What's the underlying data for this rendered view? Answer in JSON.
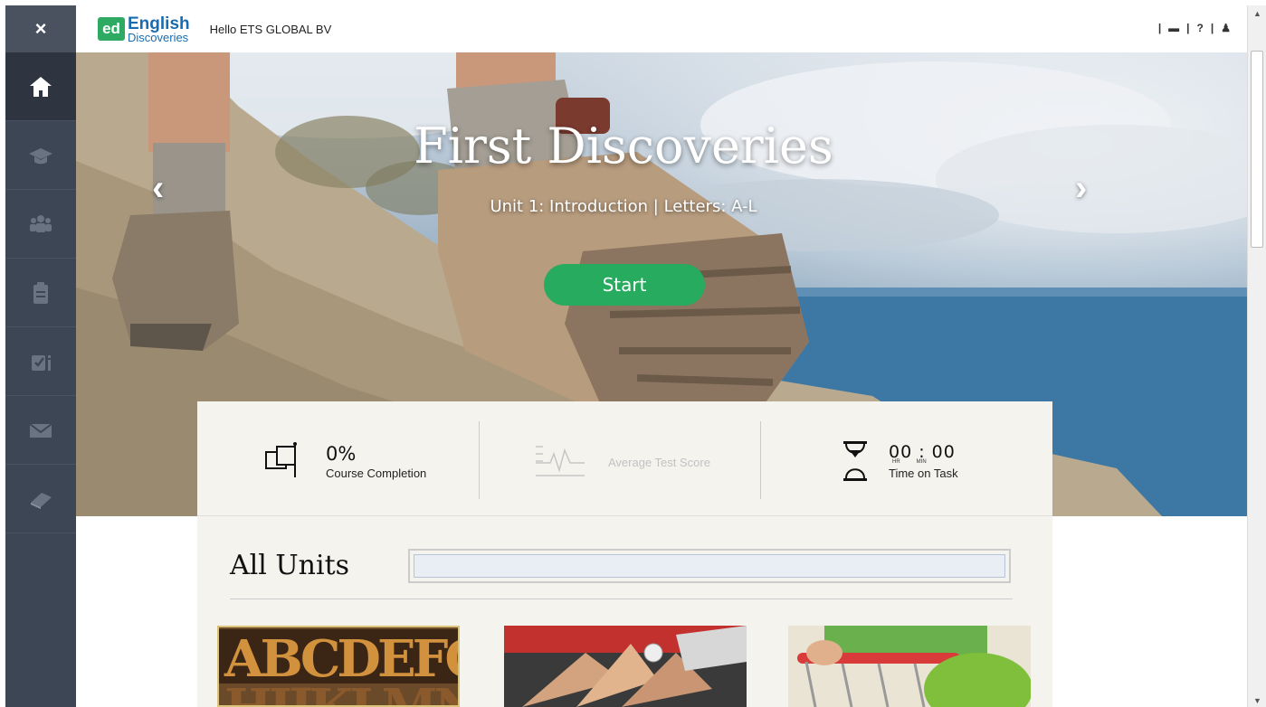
{
  "sidebar": {
    "close_label": "×",
    "items": [
      {
        "icon": "home-icon"
      },
      {
        "icon": "graduation-cap-icon"
      },
      {
        "icon": "community-icon"
      },
      {
        "icon": "clipboard-icon"
      },
      {
        "icon": "assessment-icon"
      },
      {
        "icon": "mail-icon"
      },
      {
        "icon": "book-icon"
      }
    ]
  },
  "header": {
    "logo_ed": "ed",
    "logo_line1": "English",
    "logo_line2": "Discoveries",
    "greeting": "Hello ETS GLOBAL BV",
    "icons": [
      "book-icon",
      "help-icon",
      "user-icon"
    ]
  },
  "hero": {
    "title": "First Discoveries",
    "subtitle": "Unit 1: Introduction | Letters: A-L",
    "start_label": "Start",
    "prev_label": "‹",
    "next_label": "›"
  },
  "stats": {
    "completion_value": "0%",
    "completion_label": "Course Completion",
    "score_label": "Average Test Score",
    "time_value": "00 : 00",
    "time_hr": "HR",
    "time_min": "MIN",
    "time_label": "Time on Task"
  },
  "units": {
    "title": "All Units",
    "search_value": ""
  },
  "colors": {
    "sidebar": "#3d4654",
    "accent_green": "#27ab5e",
    "brand_blue": "#1a6cb0"
  }
}
